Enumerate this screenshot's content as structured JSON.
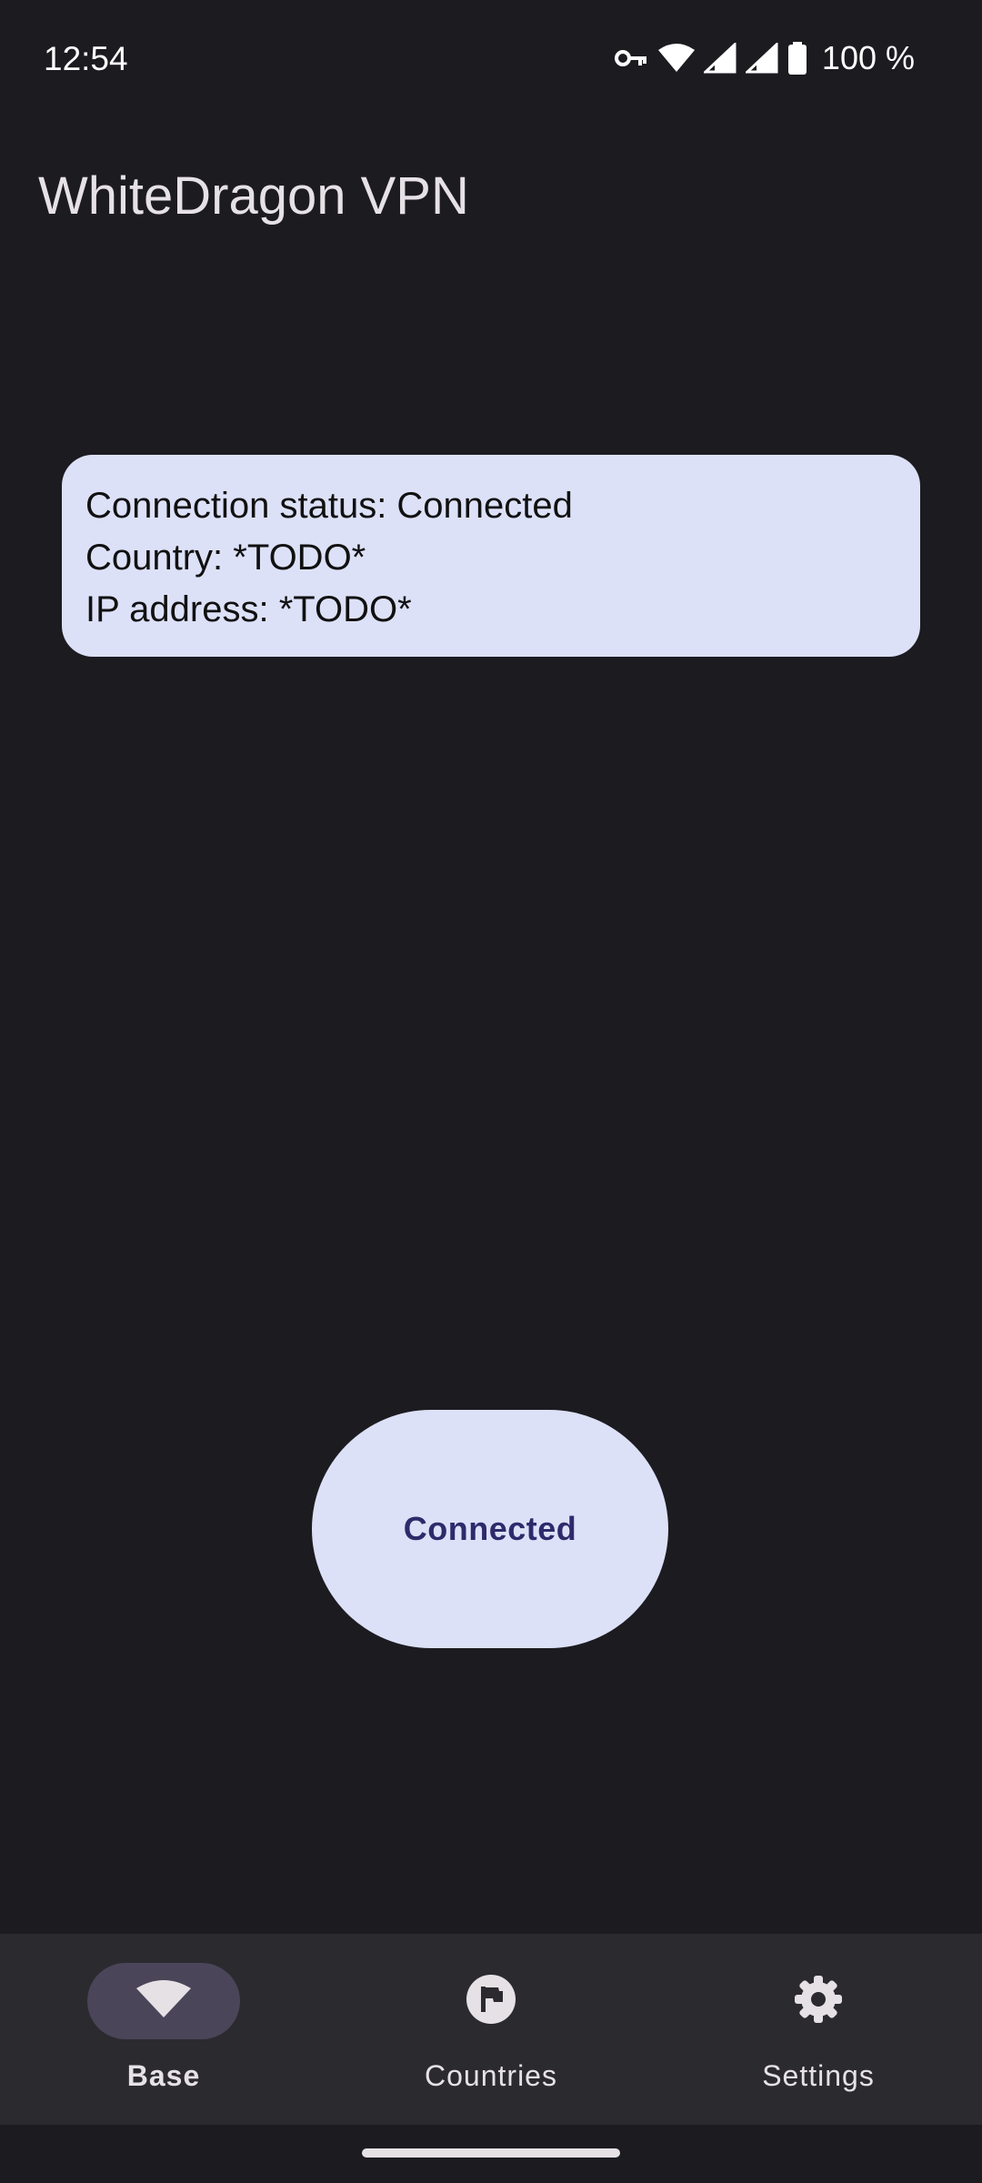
{
  "status_bar": {
    "time": "12:54",
    "battery_percent": "100 %",
    "icons": [
      "vpn-key-icon",
      "wifi-icon",
      "cell-signal-icon",
      "cell-signal-icon",
      "battery-icon"
    ]
  },
  "app": {
    "title": "WhiteDragon VPN"
  },
  "info_card": {
    "connection_status": "Connection status: Connected",
    "country": "Country: *TODO*",
    "ip_address": "IP address: *TODO*"
  },
  "connect_button": {
    "label": "Connected"
  },
  "bottom_nav": {
    "items": [
      {
        "label": "Base",
        "icon": "wifi-icon",
        "active": true
      },
      {
        "label": "Countries",
        "icon": "flag-icon",
        "active": false
      },
      {
        "label": "Settings",
        "icon": "gear-icon",
        "active": false
      }
    ]
  },
  "colors": {
    "background": "#1c1b20",
    "card": "#dde1f8",
    "button_text": "#2f2a6b",
    "nav_background": "#2b2a2f",
    "nav_active_indicator": "#4a4558"
  }
}
